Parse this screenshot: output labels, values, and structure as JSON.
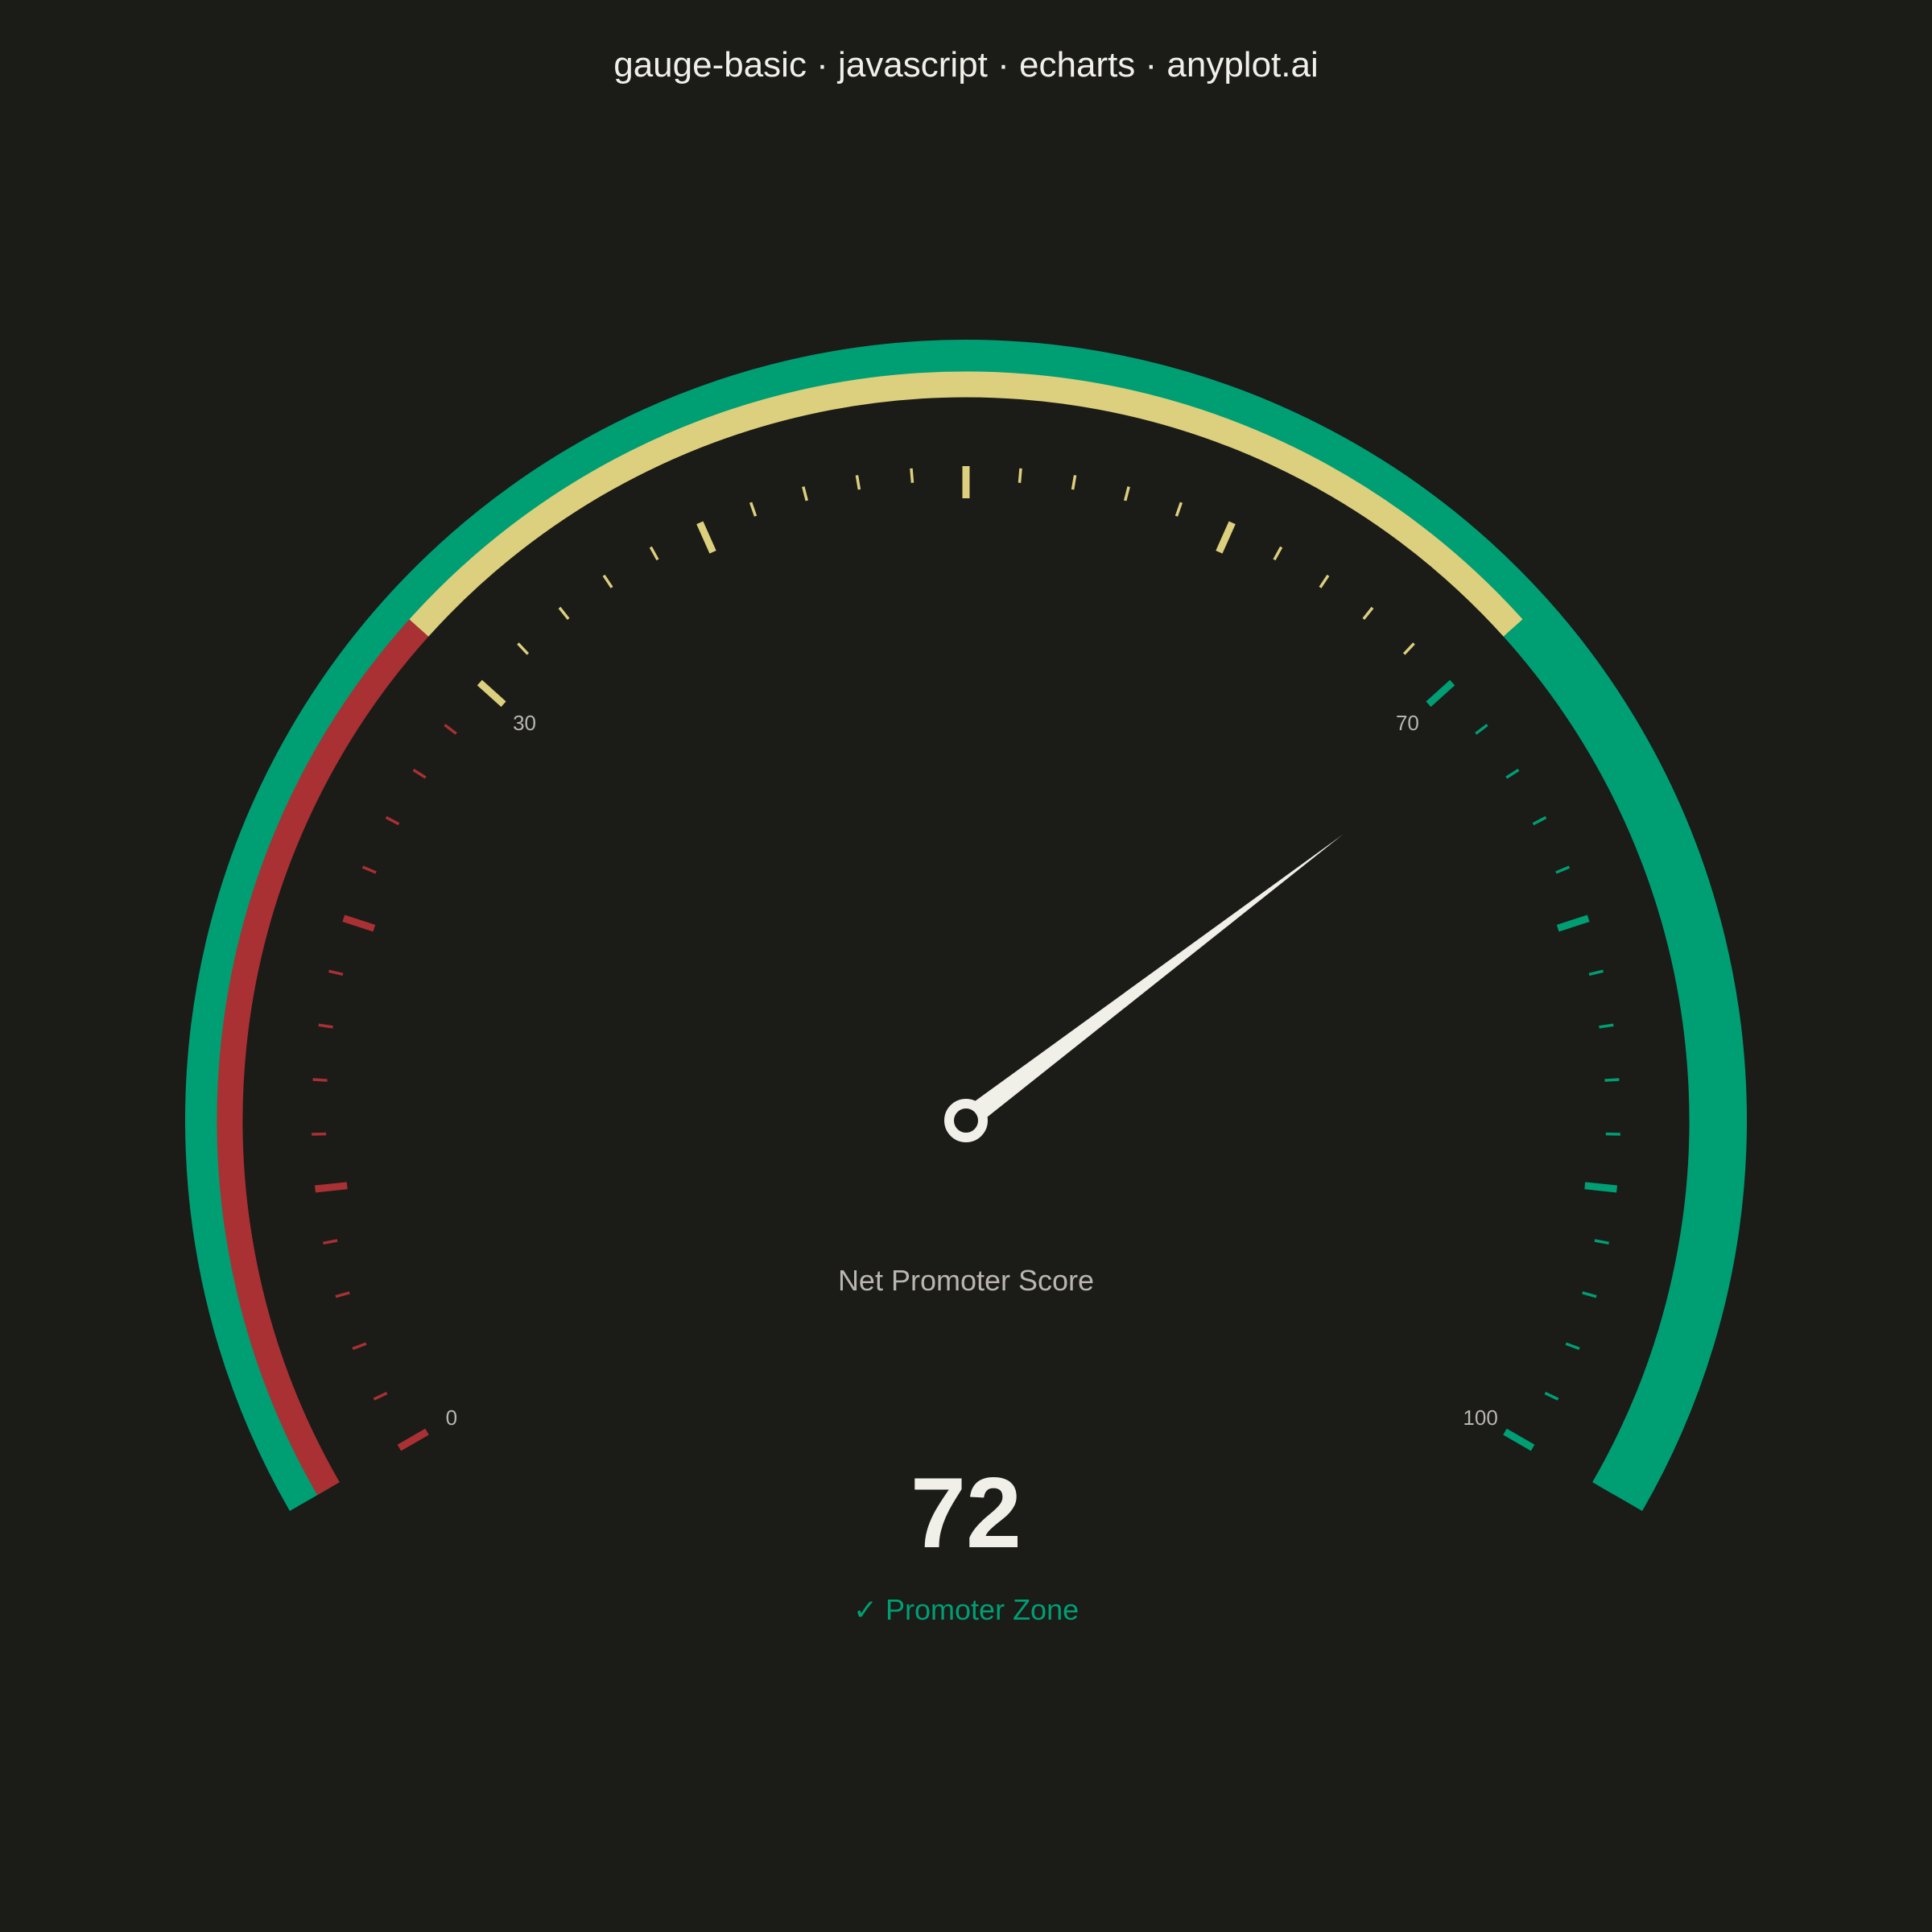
{
  "title": "gauge-basic · javascript · echarts · anyplot.ai",
  "chart_data": {
    "type": "gauge",
    "name": "Net Promoter Score",
    "value": 72,
    "display_value": "72",
    "min": 0,
    "max": 100,
    "start_angle_deg": 210,
    "end_angle_deg": -30,
    "tick_labels": [
      "0",
      "30",
      "70",
      "100"
    ],
    "tick_label_values": [
      0,
      30,
      70,
      100
    ],
    "major_ticks": [
      0,
      10,
      20,
      30,
      40,
      50,
      60,
      70,
      80,
      90,
      100
    ],
    "minor_ticks_per_major": 4,
    "bands": [
      {
        "from": 0,
        "to": 30,
        "color": "#a93033"
      },
      {
        "from": 30,
        "to": 70,
        "color": "#dccf7d"
      },
      {
        "from": 70,
        "to": 100,
        "color": "#009e73"
      }
    ],
    "progress_color": "#009e73",
    "needle_color": "#f0efe8",
    "status": "✓ Promoter Zone",
    "status_color": "#009e73"
  }
}
